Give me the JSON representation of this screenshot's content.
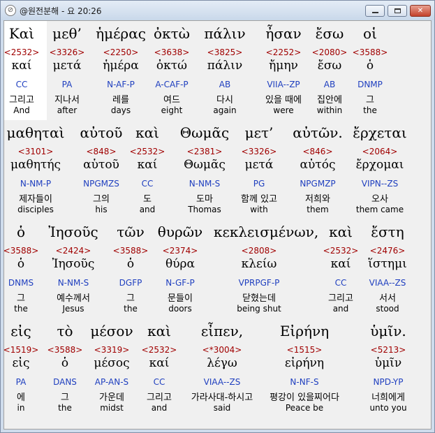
{
  "window": {
    "title": "@원전분해 - 요 20:26",
    "minimize_glyph": "",
    "maximize_glyph": "",
    "close_glyph": "✕",
    "app_icon_glyph": "⊘"
  },
  "rows": [
    {
      "words": [
        {
          "greek": "Καὶ",
          "strong": "<2532>",
          "lemma": "καί",
          "parse": "CC",
          "korean": "그리고",
          "english": "And"
        },
        {
          "greek": "μεθ’",
          "strong": "<3326>",
          "lemma": "μετά",
          "parse": "PA",
          "korean": "지나서",
          "english": "after"
        },
        {
          "greek": "ἡμέρας",
          "strong": "<2250>",
          "lemma": "ἡμέρα",
          "parse": "N-AF-P",
          "korean": "레를",
          "english": "days"
        },
        {
          "greek": "ὀκτὼ",
          "strong": "<3638>",
          "lemma": "ὀκτώ",
          "parse": "A-CAF-P",
          "korean": "여드",
          "english": "eight"
        },
        {
          "greek": "πάλιν",
          "strong": "<3825>",
          "lemma": "πάλιν",
          "parse": "AB",
          "korean": "다시",
          "english": "again"
        },
        {
          "greek": "ἦσαν",
          "strong": "<2252>",
          "lemma": "ἤμην",
          "parse": "VIIA--ZP",
          "korean": "있을 때에",
          "english": "were"
        },
        {
          "greek": "ἔσω",
          "strong": "<2080>",
          "lemma": "ἔσω",
          "parse": "AB",
          "korean": "집안에",
          "english": "within"
        },
        {
          "greek": "οἱ",
          "strong": "<3588>",
          "lemma": "ὁ",
          "parse": "DNMP",
          "korean": "그",
          "english": "the"
        }
      ]
    },
    {
      "words": [
        {
          "greek": "μαθηταὶ",
          "strong": "<3101>",
          "lemma": "μαθητής",
          "parse": "N-NM-P",
          "korean": "제자들이",
          "english": "disciples"
        },
        {
          "greek": "αὐτοῦ",
          "strong": "<848>",
          "lemma": "αὑτοῦ",
          "parse": "NPGMZS",
          "korean": "그의",
          "english": "his"
        },
        {
          "greek": "καὶ",
          "strong": "<2532>",
          "lemma": "καί",
          "parse": "CC",
          "korean": "도",
          "english": "and"
        },
        {
          "greek": "Θωμᾶς",
          "strong": "<2381>",
          "lemma": "Θωμᾶς",
          "parse": "N-NM-S",
          "korean": "도마",
          "english": "Thomas"
        },
        {
          "greek": "μετ’",
          "strong": "<3326>",
          "lemma": "μετά",
          "parse": "PG",
          "korean": "함께 있고",
          "english": "with"
        },
        {
          "greek": "αὐτῶν.",
          "strong": "<846>",
          "lemma": "αὐτός",
          "parse": "NPGMZP",
          "korean": "저희와",
          "english": "them"
        },
        {
          "greek": "ἔρχεται",
          "strong": "<2064>",
          "lemma": "ἔρχομαι",
          "parse": "VIPN--ZS",
          "korean": "오사",
          "english": "them came"
        }
      ]
    },
    {
      "words": [
        {
          "greek": "ὁ",
          "strong": "<3588>",
          "lemma": "ὁ",
          "parse": "DNMS",
          "korean": "그",
          "english": "the"
        },
        {
          "greek": "Ἰησοῦς",
          "strong": "<2424>",
          "lemma": "Ἰησοῦς",
          "parse": "N-NM-S",
          "korean": "예수께서",
          "english": "Jesus"
        },
        {
          "greek": "τῶν",
          "strong": "<3588>",
          "lemma": "ὁ",
          "parse": "DGFP",
          "korean": "그",
          "english": "the"
        },
        {
          "greek": "θυρῶν",
          "strong": "<2374>",
          "lemma": "θύρα",
          "parse": "N-GF-P",
          "korean": "문들이",
          "english": "doors"
        },
        {
          "greek": "κεκλεισμένων,",
          "strong": "<2808>",
          "lemma": "κλείω",
          "parse": "VPRPGF-P",
          "korean": "닫혔는데",
          "english": "being shut"
        },
        {
          "greek": "καὶ",
          "strong": "<2532>",
          "lemma": "καί",
          "parse": "CC",
          "korean": "그리고",
          "english": "and"
        },
        {
          "greek": "ἔστη",
          "strong": "<2476>",
          "lemma": "ἵστημι",
          "parse": "VIAA--ZS",
          "korean": "서서",
          "english": "stood"
        }
      ]
    },
    {
      "words": [
        {
          "greek": "εἰς",
          "strong": "<1519>",
          "lemma": "εἰς",
          "parse": "PA",
          "korean": "에",
          "english": "in"
        },
        {
          "greek": "τὸ",
          "strong": "<3588>",
          "lemma": "ὁ",
          "parse": "DANS",
          "korean": "그",
          "english": "the"
        },
        {
          "greek": "μέσον",
          "strong": "<3319>",
          "lemma": "μέσος",
          "parse": "AP-AN-S",
          "korean": "가운데",
          "english": "midst"
        },
        {
          "greek": "καὶ",
          "strong": "<2532>",
          "lemma": "καί",
          "parse": "CC",
          "korean": "그리고",
          "english": "and"
        },
        {
          "greek": "εἶπεν,",
          "strong": "<*3004>",
          "lemma": "λέγω",
          "parse": "VIAA--ZS",
          "korean": "가라사대-하시고",
          "english": "said"
        },
        {
          "greek": "Εἰρήνη",
          "strong": "<1515>",
          "lemma": "εἰρήνη",
          "parse": "N-NF-S",
          "korean": "평강이 있을찌어다",
          "english": "Peace be"
        },
        {
          "greek": "ὑμῖν.",
          "strong": "<5213>",
          "lemma": "ὑμῖν",
          "parse": "NPD-YP",
          "korean": "너희에게",
          "english": "unto you"
        }
      ]
    }
  ]
}
